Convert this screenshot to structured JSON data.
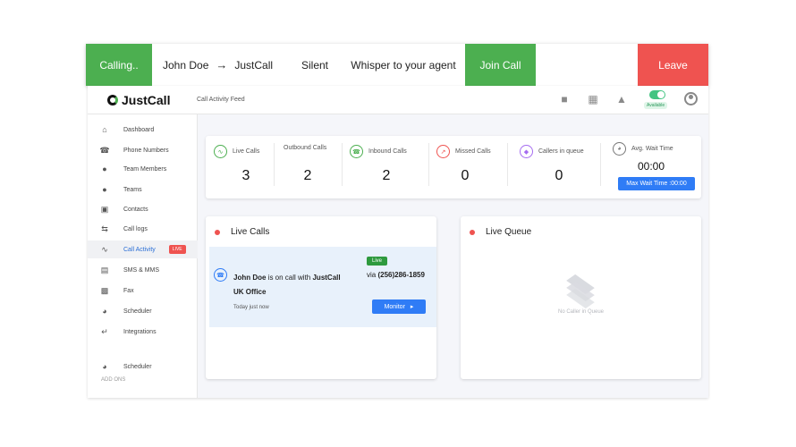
{
  "call_bar": {
    "status": "Calling..",
    "from": "John Doe",
    "arrow": "→",
    "to": "JustCall",
    "silent": "Silent",
    "whisper": "Whisper to your agent",
    "join": "Join Call",
    "leave": "Leave",
    "colors": {
      "green": "#4caf50",
      "red": "#ef5350"
    }
  },
  "header": {
    "logo": "JustCall",
    "title": "Call Activity Feed",
    "status_badge": "Available"
  },
  "sidebar": {
    "items": [
      {
        "label": "Dashboard",
        "icon": "home-icon"
      },
      {
        "label": "Phone Numbers",
        "icon": "phone-icon"
      },
      {
        "label": "Team Members",
        "icon": "users-icon"
      },
      {
        "label": "Teams",
        "icon": "group-icon"
      },
      {
        "label": "Contacts",
        "icon": "contact-card-icon"
      },
      {
        "label": "Call logs",
        "icon": "swap-icon"
      },
      {
        "label": "Call Activity",
        "icon": "pulse-icon",
        "badge": "LIVE"
      },
      {
        "label": "SMS & MMS",
        "icon": "chat-icon"
      },
      {
        "label": "Fax",
        "icon": "fax-icon"
      },
      {
        "label": "Scheduler",
        "icon": "clock-icon"
      },
      {
        "label": "Integrations",
        "icon": "integration-icon"
      }
    ],
    "addons_heading": "ADD ONS",
    "addons": [
      {
        "label": "Scheduler",
        "icon": "clock-icon"
      }
    ]
  },
  "stats": {
    "live_calls": {
      "label": "Live Calls",
      "value": "3"
    },
    "outbound_calls": {
      "label": "Outbound Calls",
      "value": "2"
    },
    "inbound_calls": {
      "label": "Inbound Calls",
      "value": "2"
    },
    "missed_calls": {
      "label": "Missed Calls",
      "value": "0"
    },
    "callers_in_queue": {
      "label": "Callers in queue",
      "value": "0"
    },
    "avg_wait": {
      "label": "Avg. Wait Time",
      "value": "00:00",
      "max_label": "Max Wait Time :00:00"
    }
  },
  "live_calls_panel": {
    "title": "Live Calls",
    "call": {
      "caller": "John Doe",
      "text_mid": " is on call with ",
      "agent": "JustCall",
      "line2": "UK Office",
      "badge": "Live",
      "via_prefix": "via ",
      "number": "(256)286-1859",
      "time": "Today just now",
      "monitor": "Monitor"
    }
  },
  "live_queue_panel": {
    "title": "Live Queue",
    "empty_text": "No Caller in Queue"
  }
}
